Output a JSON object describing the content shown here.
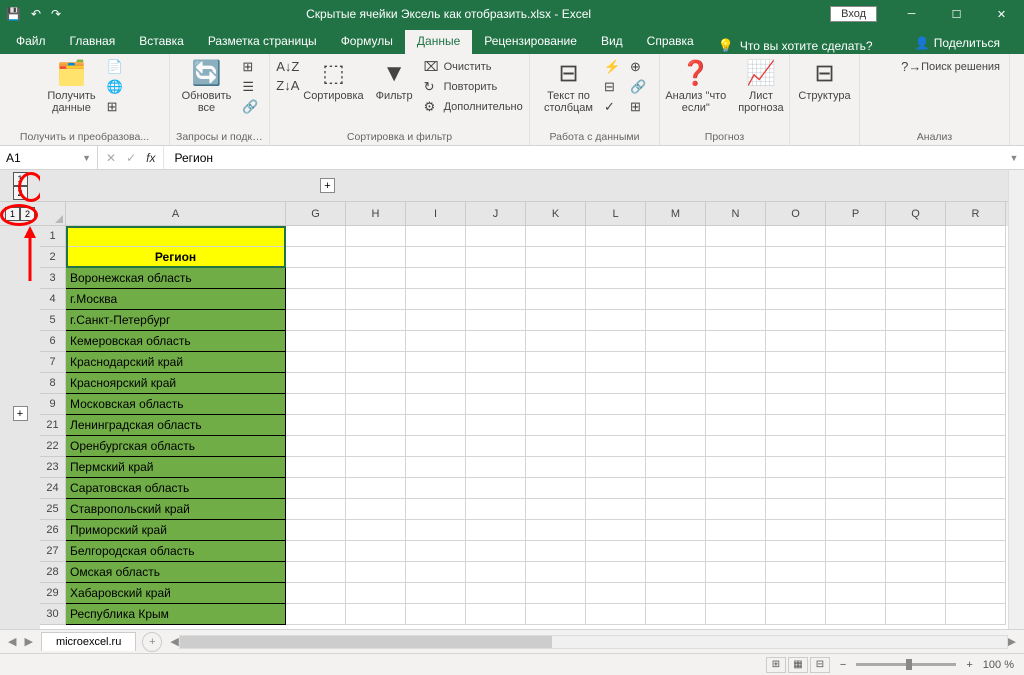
{
  "titlebar": {
    "title": "Скрытые ячейки Эксель как отобразить.xlsx - Excel",
    "login": "Вход"
  },
  "tabs": {
    "file": "Файл",
    "home": "Главная",
    "insert": "Вставка",
    "layout": "Разметка страницы",
    "formulas": "Формулы",
    "data": "Данные",
    "review": "Рецензирование",
    "view": "Вид",
    "help": "Справка",
    "tellme": "Что вы хотите сделать?",
    "share": "Поделиться"
  },
  "ribbon": {
    "get_data": "Получить\nданные",
    "group1": "Получить и преобразова...",
    "refresh": "Обновить\nвсе",
    "group2": "Запросы и подключе...",
    "sort": "Сортировка",
    "filter": "Фильтр",
    "clear": "Очистить",
    "reapply": "Повторить",
    "advanced": "Дополнительно",
    "group3": "Сортировка и фильтр",
    "text_cols": "Текст по\nстолбцам",
    "group4": "Работа с данными",
    "whatif": "Анализ \"что\nесли\"",
    "forecast": "Лист\nпрогноза",
    "group5": "Прогноз",
    "outline": "Структура",
    "solver": "Поиск решения",
    "group6": "Анализ"
  },
  "namebox": "A1",
  "formula_value": "Регион",
  "columns": [
    "A",
    "G",
    "H",
    "I",
    "J",
    "K",
    "L",
    "M",
    "N",
    "O",
    "P",
    "Q",
    "R"
  ],
  "rows": [
    {
      "n": 1,
      "val": "",
      "cls": "yellow"
    },
    {
      "n": 2,
      "val": "Регион",
      "cls": "yellow header-text"
    },
    {
      "n": 3,
      "val": "Воронежская область",
      "cls": "green"
    },
    {
      "n": 4,
      "val": "г.Москва",
      "cls": "green"
    },
    {
      "n": 5,
      "val": "г.Санкт-Петербург",
      "cls": "green"
    },
    {
      "n": 6,
      "val": "Кемеровская область",
      "cls": "green"
    },
    {
      "n": 7,
      "val": "Краснодарский край",
      "cls": "green"
    },
    {
      "n": 8,
      "val": "Красноярский край",
      "cls": "green"
    },
    {
      "n": 9,
      "val": "Московская область",
      "cls": "green"
    },
    {
      "n": 21,
      "val": "Ленинградская область",
      "cls": "green"
    },
    {
      "n": 22,
      "val": "Оренбургская область",
      "cls": "green"
    },
    {
      "n": 23,
      "val": "Пермский край",
      "cls": "green"
    },
    {
      "n": 24,
      "val": "Саратовская область",
      "cls": "green"
    },
    {
      "n": 25,
      "val": "Ставропольский край",
      "cls": "green"
    },
    {
      "n": 26,
      "val": "Приморский край",
      "cls": "green"
    },
    {
      "n": 27,
      "val": "Белгородская область",
      "cls": "green"
    },
    {
      "n": 28,
      "val": "Омская область",
      "cls": "green"
    },
    {
      "n": 29,
      "val": "Хабаровский край",
      "cls": "green"
    },
    {
      "n": 30,
      "val": "Республика Крым",
      "cls": "green"
    }
  ],
  "sheet_name": "microexcel.ru",
  "zoom": "100 %"
}
